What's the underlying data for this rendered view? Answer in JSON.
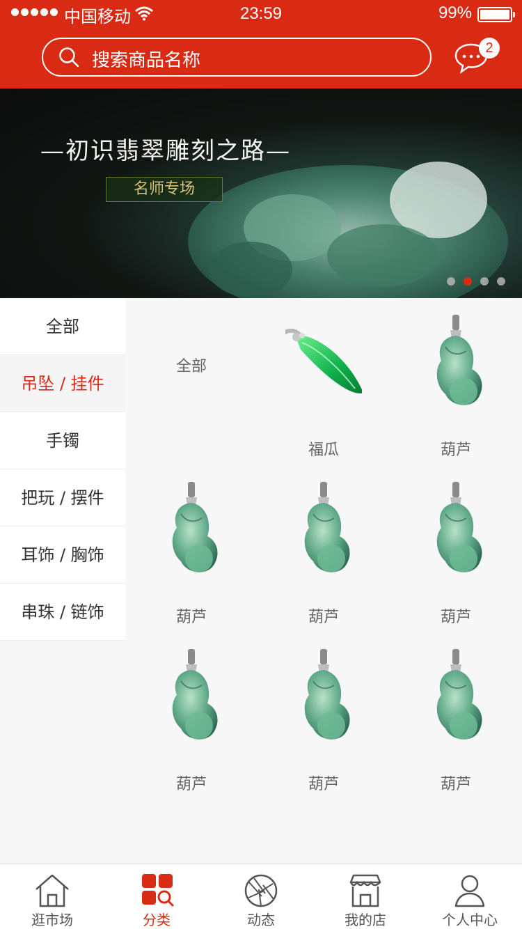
{
  "status_bar": {
    "carrier": "中国移动",
    "time": "23:59",
    "battery": "99%"
  },
  "search": {
    "placeholder": "搜索商品名称"
  },
  "messages": {
    "badge": "2"
  },
  "banner": {
    "title": "—初识翡翠雕刻之路—",
    "tag": "名师专场",
    "active_dot": 1,
    "dot_count": 4
  },
  "sidebar": {
    "items": [
      {
        "label": "全部",
        "active": false
      },
      {
        "label": "吊坠 / 挂件",
        "active": true
      },
      {
        "label": "手镯",
        "active": false
      },
      {
        "label": "把玩 / 摆件",
        "active": false
      },
      {
        "label": "耳饰 / 胸饰",
        "active": false
      },
      {
        "label": "串珠 / 链饰",
        "active": false
      }
    ]
  },
  "grid": {
    "items": [
      {
        "label": "全部",
        "icon": "none"
      },
      {
        "label": "福瓜",
        "icon": "jade-bean-pendant-icon"
      },
      {
        "label": "葫芦",
        "icon": "jade-gourd-pendant-icon"
      },
      {
        "label": "葫芦",
        "icon": "jade-gourd-pendant-icon"
      },
      {
        "label": "葫芦",
        "icon": "jade-gourd-pendant-icon"
      },
      {
        "label": "葫芦",
        "icon": "jade-gourd-pendant-icon"
      },
      {
        "label": "葫芦",
        "icon": "jade-gourd-pendant-icon"
      },
      {
        "label": "葫芦",
        "icon": "jade-gourd-pendant-icon"
      },
      {
        "label": "葫芦",
        "icon": "jade-gourd-pendant-icon"
      }
    ]
  },
  "tabbar": {
    "items": [
      {
        "label": "逛市场",
        "icon": "home-icon"
      },
      {
        "label": "分类",
        "icon": "category-icon",
        "active": true
      },
      {
        "label": "动态",
        "icon": "aperture-icon"
      },
      {
        "label": "我的店",
        "icon": "store-icon"
      },
      {
        "label": "个人中心",
        "icon": "user-icon"
      }
    ]
  },
  "colors": {
    "brand": "#d92b14",
    "inactive": "#555555",
    "background": "#f7f7f7"
  }
}
